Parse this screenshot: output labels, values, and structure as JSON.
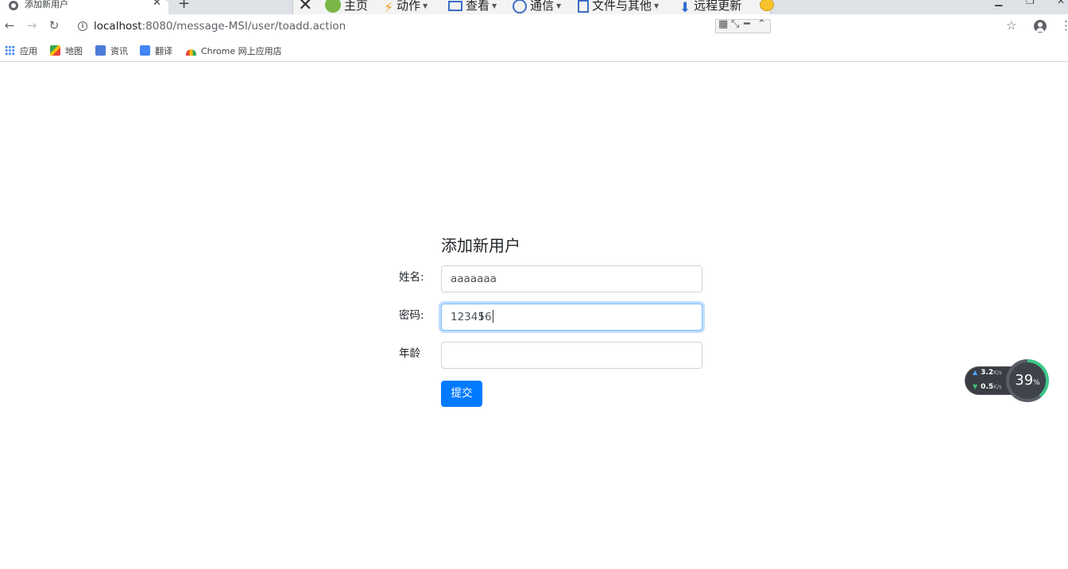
{
  "browser": {
    "tab_title": "添加新用户",
    "tab_close": "✕",
    "new_tab": "+",
    "url_host": "localhost",
    "url_path": ":8080/message-MSI/user/toadd.action",
    "bookmarks": [
      "应用",
      "地图",
      "资讯",
      "翻译",
      "Chrome 网上应用店"
    ]
  },
  "remote_toolbar": {
    "items": [
      "主页",
      "动作",
      "查看",
      "通信",
      "文件与其他",
      "远程更新"
    ]
  },
  "form": {
    "title": "添加新用户",
    "name_label": "姓名:",
    "name_value": "aaaaaaa",
    "password_label": "密码:",
    "password_value": "123456",
    "age_label": "年龄",
    "age_value": "",
    "submit_label": "提交"
  },
  "net_widget": {
    "upload": "3.2",
    "upload_unit": "K/s",
    "download": "0.5",
    "download_unit": "K/s",
    "cpu_percent": "39",
    "cpu_unit": "%"
  },
  "colors": {
    "primary": "#007bff",
    "focus_ring": "#80bdff"
  }
}
